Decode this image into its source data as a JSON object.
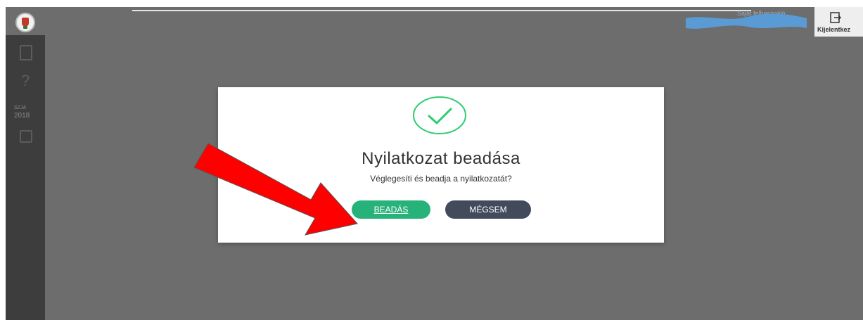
{
  "colors": {
    "overlay": "#6d6d6d",
    "sidebar": "#3d3d3d",
    "submit_button": "#27b27a",
    "cancel_button": "#424a5c",
    "success_check": "#2ecc71",
    "annotation_arrow": "#ff0000"
  },
  "sidebar": {
    "items": [
      {
        "icon": "document-list-icon"
      },
      {
        "icon": "help-icon",
        "label": "?"
      },
      {
        "icon": "year-2018-icon",
        "small_label": "SZJA",
        "label": "2018"
      },
      {
        "icon": "save-icon"
      }
    ]
  },
  "header": {
    "user_name": "Saját felhasználó",
    "logout_label": "Kijelentkez"
  },
  "dialog": {
    "icon": "check-circle-icon",
    "title": "Nyilatkozat beadása",
    "subtitle": "Véglegesíti és beadja a nyilatkozatát?",
    "submit_label": "BEADÁS",
    "cancel_label": "MÉGSEM"
  },
  "annotation": {
    "icon": "red-arrow-icon"
  }
}
